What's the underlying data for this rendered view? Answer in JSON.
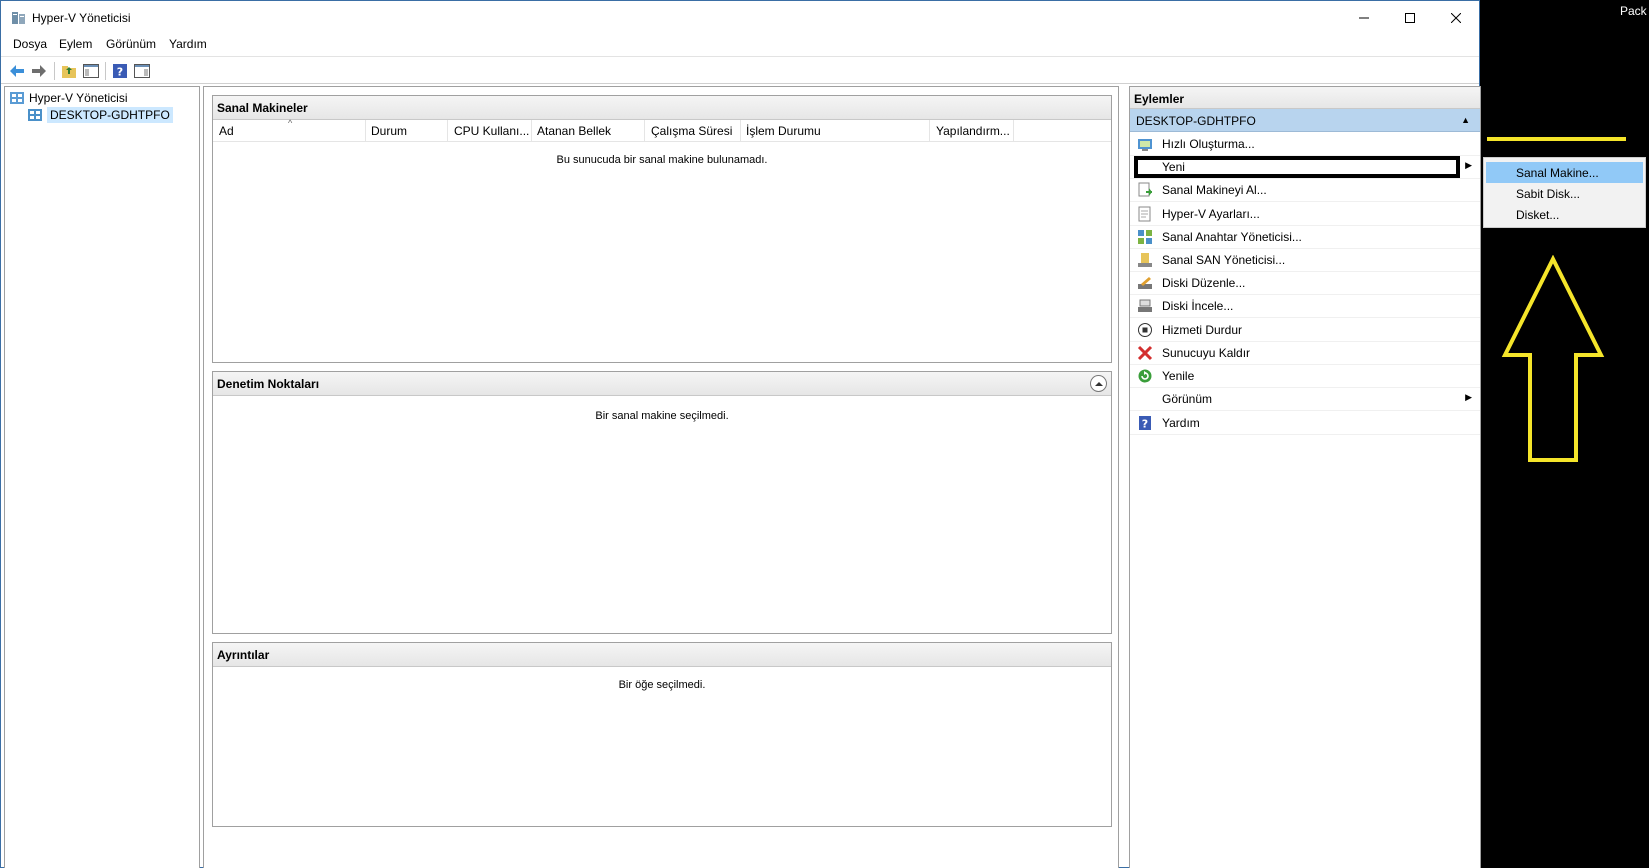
{
  "window": {
    "title": "Hyper-V Yöneticisi",
    "controls": {
      "minimize": "—",
      "maximize": "☐",
      "close": "✕"
    }
  },
  "menu": [
    "Dosya",
    "Eylem",
    "Görünüm",
    "Yardım"
  ],
  "toolbar": {
    "icons": [
      "back-icon",
      "forward-icon",
      "up-folder-icon",
      "show-hide-tree-icon",
      "help-icon",
      "show-hide-action-pane-icon"
    ]
  },
  "tree": {
    "root": "Hyper-V Yöneticisi",
    "child": "DESKTOP-GDHTPFO"
  },
  "panels": {
    "vms": {
      "title": "Sanal Makineler",
      "columns": [
        "Ad",
        "Durum",
        "CPU Kullanı...",
        "Atanan Bellek",
        "Çalışma Süresi",
        "İşlem Durumu",
        "Yapılandırm..."
      ],
      "empty": "Bu sunucuda bir sanal makine bulunamadı."
    },
    "checkpoints": {
      "title": "Denetim Noktaları",
      "empty": "Bir sanal makine seçilmedi."
    },
    "details": {
      "title": "Ayrıntılar",
      "empty": "Bir öğe seçilmedi."
    }
  },
  "actions": {
    "header": "Eylemler",
    "group": "DESKTOP-GDHTPFO",
    "items": [
      {
        "label": "Hızlı Oluşturma...",
        "icon": "quick-create-icon"
      },
      {
        "label": "Yeni",
        "icon": "",
        "submenu": true,
        "highlighted": true
      },
      {
        "label": "Sanal Makineyi Al...",
        "icon": "import-vm-icon"
      },
      {
        "label": "Hyper-V Ayarları...",
        "icon": "settings-icon"
      },
      {
        "label": "Sanal Anahtar Yöneticisi...",
        "icon": "virtual-switch-icon"
      },
      {
        "label": "Sanal SAN Yöneticisi...",
        "icon": "san-manager-icon"
      },
      {
        "label": "Diski Düzenle...",
        "icon": "edit-disk-icon"
      },
      {
        "label": "Diski İncele...",
        "icon": "inspect-disk-icon"
      },
      {
        "label": "Hizmeti Durdur",
        "icon": "stop-service-icon"
      },
      {
        "label": "Sunucuyu Kaldır",
        "icon": "remove-server-icon"
      },
      {
        "label": "Yenile",
        "icon": "refresh-icon"
      },
      {
        "label": "Görünüm",
        "icon": "",
        "submenu": true
      },
      {
        "label": "Yardım",
        "icon": "help-icon"
      }
    ]
  },
  "submenu": {
    "items": [
      {
        "label": "Sanal Makine...",
        "active": true
      },
      {
        "label": "Sabit Disk...",
        "active": false
      },
      {
        "label": "Disket...",
        "active": false
      }
    ]
  },
  "overlay": {
    "corner_text": "Pack",
    "accent": "#f5e52a"
  }
}
